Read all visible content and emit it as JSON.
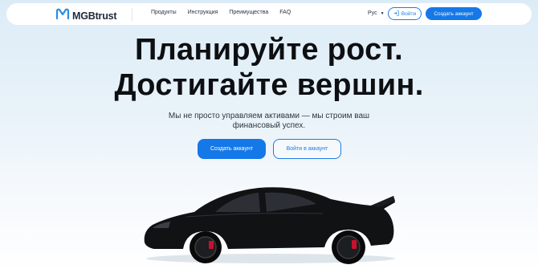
{
  "header": {
    "brand": "MGBtrust",
    "nav": [
      "Продукты",
      "Инструкция",
      "Преимущества",
      "FAQ"
    ],
    "language": "Рус",
    "login_label": "Войти",
    "create_label": "Создать аккаунт"
  },
  "hero": {
    "title_line1": "Планируйте рост.",
    "title_line2": "Достигайте вершин.",
    "subtitle_line1": "Мы не просто управляем активами — мы строим ваш",
    "subtitle_line2": "финансовый успех.",
    "create_button": "Создать аккаунт",
    "login_button": "Войти в аккаунт"
  },
  "colors": {
    "accent": "#1578e8",
    "text": "#0d0f12"
  },
  "icons": {
    "logo": "brand-m-logo-icon",
    "login": "login-arrow-icon",
    "language_caret": "caret-down-icon"
  }
}
